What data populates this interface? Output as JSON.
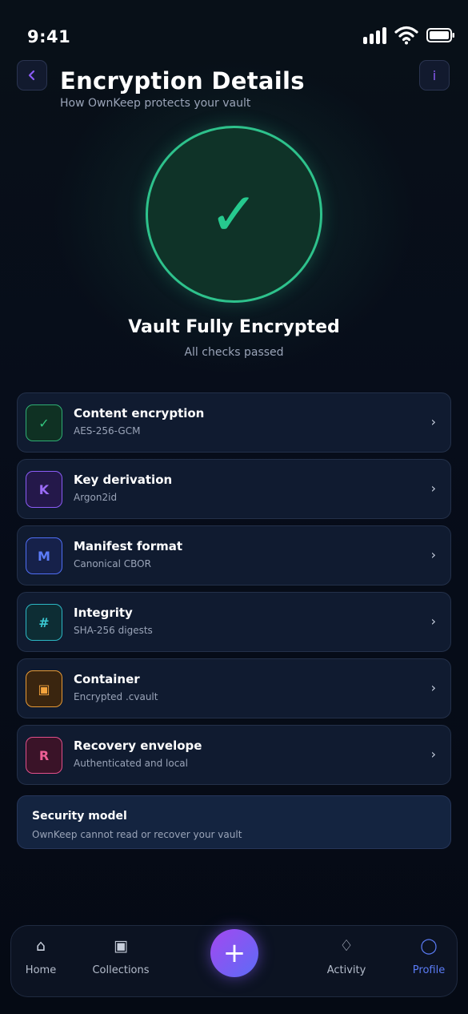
{
  "status_bar": {
    "time": "9:41"
  },
  "header": {
    "back_icon": "chevron-left-icon",
    "info_icon": "info-icon",
    "info_glyph": "i",
    "title": "Encryption Details",
    "subtitle": "How OwnKeep protects your vault"
  },
  "hero": {
    "icon": "checkmark-icon",
    "title": "Vault Fully Encrypted",
    "subtitle": "All checks passed",
    "accent": "#2ec28c"
  },
  "details": [
    {
      "glyph": "✓",
      "icon": "check-icon",
      "color": "green",
      "title": "Content encryption",
      "value": "AES-256-GCM"
    },
    {
      "glyph": "K",
      "icon": "key-letter-icon",
      "color": "purple",
      "title": "Key derivation",
      "value": "Argon2id"
    },
    {
      "glyph": "M",
      "icon": "manifest-letter-icon",
      "color": "blue",
      "title": "Manifest format",
      "value": "Canonical CBOR"
    },
    {
      "glyph": "#",
      "icon": "hash-icon",
      "color": "teal",
      "title": "Integrity",
      "value": "SHA-256 digests"
    },
    {
      "glyph": "▣",
      "icon": "container-icon",
      "color": "orange",
      "title": "Container",
      "value": "Encrypted .cvault"
    },
    {
      "glyph": "R",
      "icon": "recovery-letter-icon",
      "color": "pink",
      "title": "Recovery envelope",
      "value": "Authenticated and local"
    }
  ],
  "security_model": {
    "title": "Security model",
    "text": "OwnKeep cannot read or recover your vault"
  },
  "tabbar": {
    "tabs": [
      {
        "label": "Home",
        "icon": "home-icon",
        "glyph": "⌂"
      },
      {
        "label": "Collections",
        "icon": "collections-icon",
        "glyph": "▣"
      },
      {
        "label": "Activity",
        "icon": "activity-icon",
        "glyph": "♢"
      },
      {
        "label": "Profile",
        "icon": "profile-icon",
        "glyph": "◯",
        "active": true
      }
    ],
    "fab_glyph": "+",
    "active_color": "#5b7cf6"
  }
}
